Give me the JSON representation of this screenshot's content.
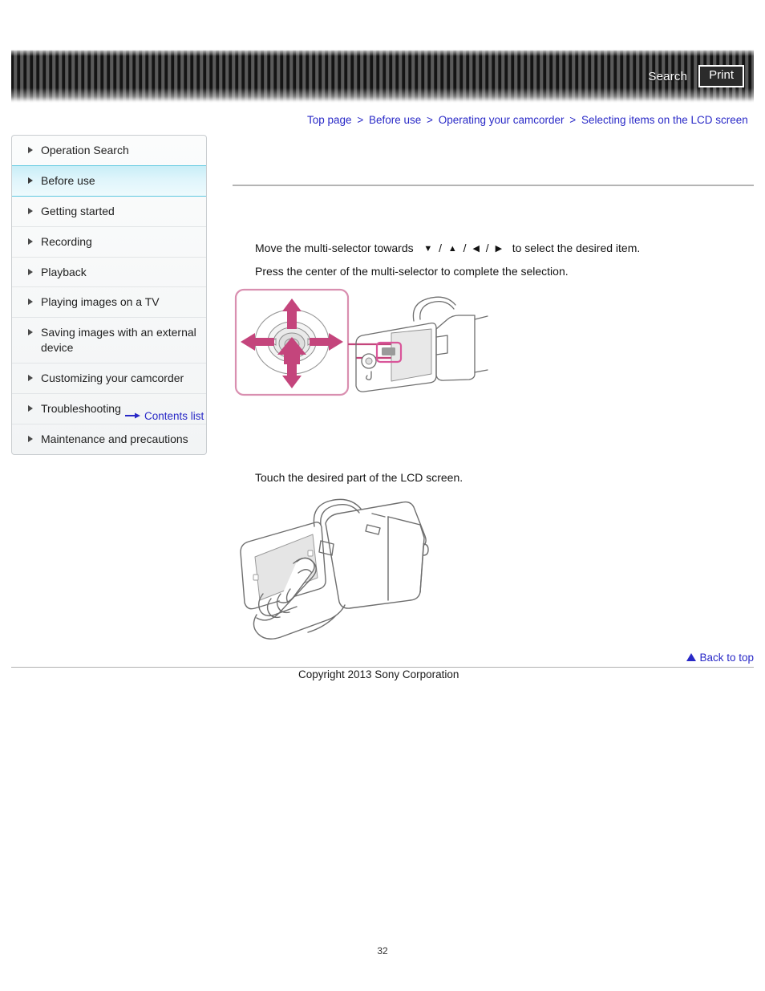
{
  "header": {
    "search_label": "Search",
    "print_label": "Print"
  },
  "breadcrumb": {
    "separator": ">",
    "items": [
      {
        "label": "Top page"
      },
      {
        "label": "Before use"
      },
      {
        "label": "Operating your camcorder"
      },
      {
        "label": "Selecting items on the LCD screen"
      }
    ]
  },
  "sidebar": {
    "items": [
      {
        "label": "Operation Search",
        "active": false
      },
      {
        "label": "Before use",
        "active": true
      },
      {
        "label": "Getting started",
        "active": false
      },
      {
        "label": "Recording",
        "active": false
      },
      {
        "label": "Playback",
        "active": false
      },
      {
        "label": "Playing images on a TV",
        "active": false
      },
      {
        "label": "Saving images with an external device",
        "active": false
      },
      {
        "label": "Customizing your camcorder",
        "active": false
      },
      {
        "label": "Troubleshooting",
        "active": false
      },
      {
        "label": "Maintenance and precautions",
        "active": false
      }
    ],
    "contents_link": "Contents list"
  },
  "main": {
    "instruction_1_prefix": "Move the multi-selector towards",
    "instruction_1_suffix": "to select the desired item.",
    "direction_glyphs": [
      "▼",
      "▲",
      "◀",
      "▶"
    ],
    "instruction_2": "Press the center of the multi-selector to complete the selection.",
    "instruction_3": "Touch the desired part of the LCD screen.",
    "figure_1_caption": "multi-selector diagram on camcorder",
    "figure_2_caption": "hand touching camcorder LCD screen"
  },
  "footer": {
    "back_to_top": "Back to top",
    "copyright": "Copyright 2013 Sony Corporation",
    "page_number": "32"
  },
  "colors": {
    "link": "#2929c7",
    "accent_pink": "#c44a78",
    "highlight_cyan": "#5ec8e0",
    "header_dark": "#141414"
  }
}
